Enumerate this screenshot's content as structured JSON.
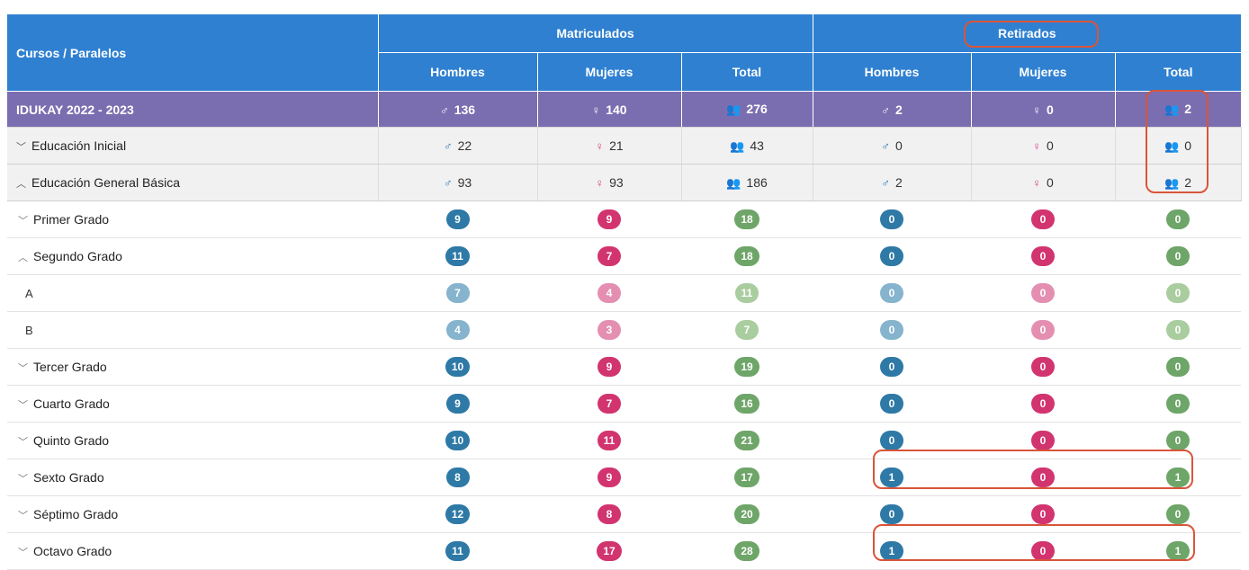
{
  "header": {
    "corner": "Cursos / Paralelos",
    "group_enrolled": "Matriculados",
    "group_withdrawn": "Retirados",
    "sub": [
      "Hombres",
      "Mujeres",
      "Total",
      "Hombres",
      "Mujeres",
      "Total"
    ]
  },
  "year_row": {
    "label": "IDUKAY 2022 - 2023",
    "values": [
      "136",
      "140",
      "276",
      "2",
      "0",
      "2"
    ]
  },
  "levels": [
    {
      "label": "Educación Inicial",
      "values": [
        "22",
        "21",
        "43",
        "0",
        "0",
        "0"
      ]
    },
    {
      "label": "Educación General Básica",
      "values": [
        "93",
        "93",
        "186",
        "2",
        "0",
        "2"
      ]
    }
  ],
  "grades": [
    {
      "label": "Primer Grado",
      "values": [
        "9",
        "9",
        "18",
        "0",
        "0",
        "0"
      ]
    },
    {
      "label": "Segundo Grado",
      "values": [
        "11",
        "7",
        "18",
        "0",
        "0",
        "0"
      ]
    },
    {
      "label": "A",
      "values": [
        "7",
        "4",
        "11",
        "0",
        "0",
        "0"
      ]
    },
    {
      "label": "B",
      "values": [
        "4",
        "3",
        "7",
        "0",
        "0",
        "0"
      ]
    },
    {
      "label": "Tercer Grado",
      "values": [
        "10",
        "9",
        "19",
        "0",
        "0",
        "0"
      ]
    },
    {
      "label": "Cuarto Grado",
      "values": [
        "9",
        "7",
        "16",
        "0",
        "0",
        "0"
      ]
    },
    {
      "label": "Quinto Grado",
      "values": [
        "10",
        "11",
        "21",
        "0",
        "0",
        "0"
      ]
    },
    {
      "label": "Sexto Grado",
      "values": [
        "8",
        "9",
        "17",
        "1",
        "0",
        "1"
      ]
    },
    {
      "label": "Séptimo Grado",
      "values": [
        "12",
        "8",
        "20",
        "0",
        "0",
        "0"
      ]
    },
    {
      "label": "Octavo Grado",
      "values": [
        "11",
        "17",
        "28",
        "1",
        "0",
        "1"
      ]
    }
  ],
  "colors": {
    "header": "#2f80d1",
    "year_row": "#7b6eb0",
    "male": "#2e79a6",
    "female": "#d2346f",
    "total": "#6ea568",
    "highlight": "#d9553a"
  }
}
